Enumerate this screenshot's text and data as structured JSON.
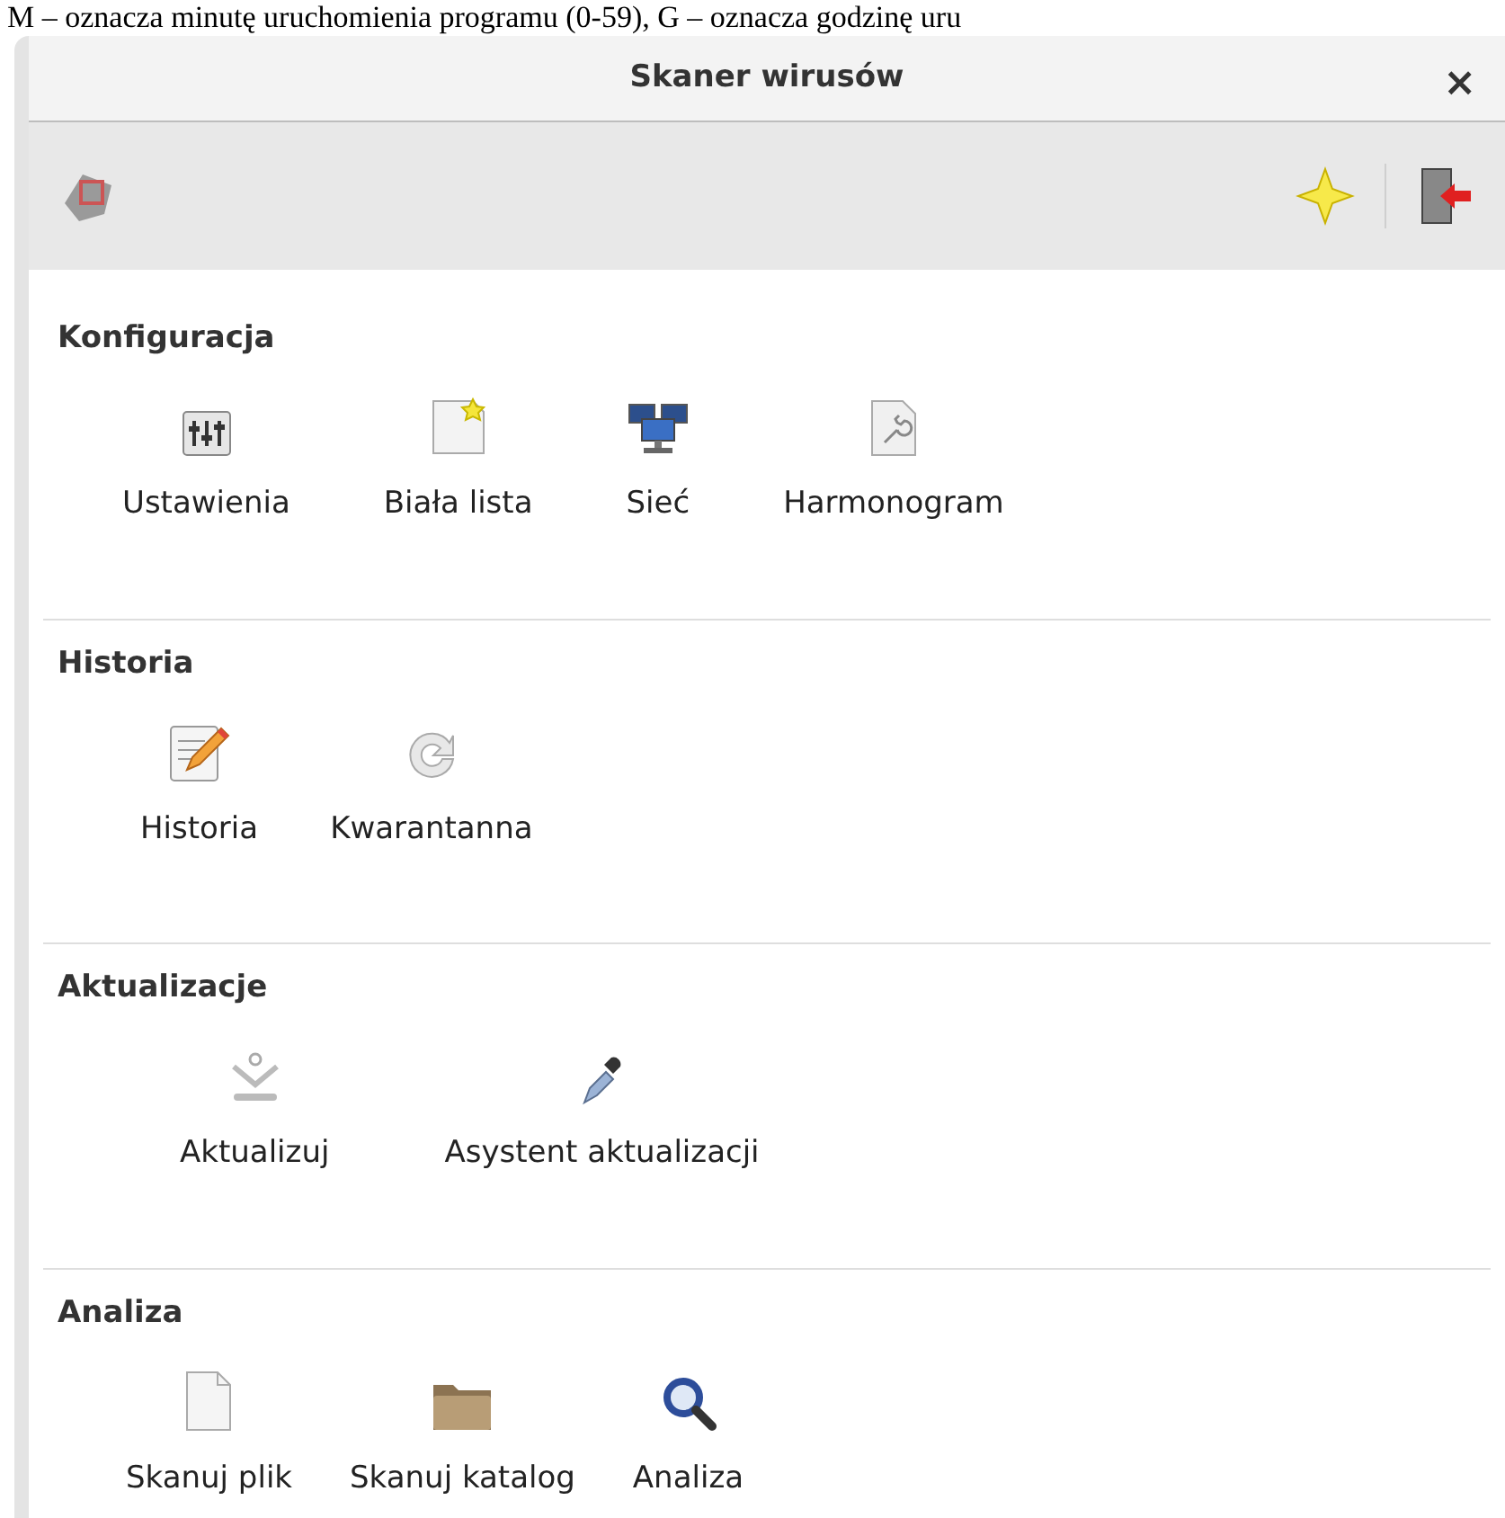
{
  "document_text": "M – oznacza minutę uruchomienia programu (0-59), G – oznacza godzinę uru",
  "window": {
    "title": "Skaner wirusów",
    "close": "×"
  },
  "sections": [
    {
      "heading": "Konfiguracja",
      "items": [
        {
          "label": "Ustawienia"
        },
        {
          "label": "Biała lista"
        },
        {
          "label": "Sieć"
        },
        {
          "label": "Harmonogram"
        }
      ]
    },
    {
      "heading": "Historia",
      "items": [
        {
          "label": "Historia"
        },
        {
          "label": "Kwarantanna"
        }
      ]
    },
    {
      "heading": "Aktualizacje",
      "items": [
        {
          "label": "Aktualizuj"
        },
        {
          "label": "Asystent aktualizacji"
        }
      ]
    },
    {
      "heading": "Analiza",
      "items": [
        {
          "label": "Skanuj plik"
        },
        {
          "label": "Skanuj katalog"
        },
        {
          "label": "Analiza"
        }
      ]
    }
  ]
}
